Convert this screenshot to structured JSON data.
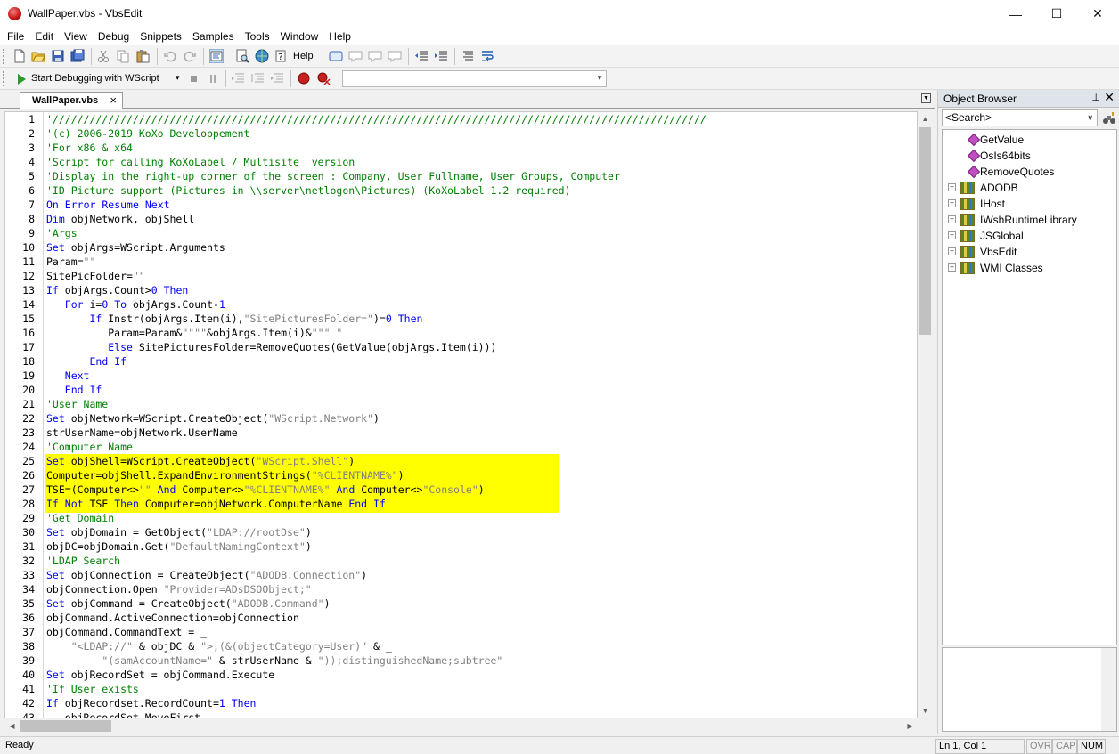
{
  "window": {
    "title": "WallPaper.vbs - VbsEdit",
    "minimize": "—",
    "maximize": "☐",
    "close": "✕"
  },
  "menu": [
    "File",
    "Edit",
    "View",
    "Debug",
    "Snippets",
    "Samples",
    "Tools",
    "Window",
    "Help"
  ],
  "toolbar": {
    "help_label": "Help",
    "debug_label": "Start Debugging with WScript",
    "debug_dropdown": "▾",
    "combo_value": ""
  },
  "editor": {
    "tab_label": "WallPaper.vbs",
    "tab_close": "×",
    "highlight_color": "#ffff00",
    "colors": {
      "comment": "#008000",
      "keyword": "#0000ff",
      "string": "#808080",
      "number": "#0000ff"
    },
    "lines": [
      {
        "n": "1",
        "t": "'//////////////////////////////////////////////////////////////////////////////////////////////////////////"
      },
      {
        "n": "2",
        "t": "'(c) 2006-2019 KoXo Developpement"
      },
      {
        "n": "3",
        "t": "'For x86 & x64"
      },
      {
        "n": "4",
        "t": "'Script for calling KoXoLabel / Multisite  version"
      },
      {
        "n": "5",
        "t": "'Display in the right-up corner of the screen : Company, User Fullname, User Groups, Computer"
      },
      {
        "n": "6",
        "t": "'ID Picture support (Pictures in \\\\server\\netlogon\\Pictures) (KoXoLabel 1.2 required)"
      },
      {
        "n": "7",
        "t": "On Error Resume Next"
      },
      {
        "n": "8",
        "t": "Dim objNetwork, objShell"
      },
      {
        "n": "9",
        "t": "'Args"
      },
      {
        "n": "10",
        "t": "Set objArgs=WScript.Arguments"
      },
      {
        "n": "11",
        "t": "Param=\"\""
      },
      {
        "n": "12",
        "t": "SitePicFolder=\"\""
      },
      {
        "n": "13",
        "t": "If objArgs.Count>0 Then"
      },
      {
        "n": "14",
        "t": "   For i=0 To objArgs.Count-1"
      },
      {
        "n": "15",
        "t": "       If Instr(objArgs.Item(i),\"SitePicturesFolder=\")=0 Then"
      },
      {
        "n": "16",
        "t": "          Param=Param&\"\"\"\"&objArgs.Item(i)&\"\"\" \""
      },
      {
        "n": "17",
        "t": "          Else SitePicturesFolder=RemoveQuotes(GetValue(objArgs.Item(i)))"
      },
      {
        "n": "18",
        "t": "       End If"
      },
      {
        "n": "19",
        "t": "   Next"
      },
      {
        "n": "20",
        "t": "   End If"
      },
      {
        "n": "21",
        "t": "'User Name"
      },
      {
        "n": "22",
        "t": "Set objNetwork=WScript.CreateObject(\"WScript.Network\")"
      },
      {
        "n": "23",
        "t": "strUserName=objNetwork.UserName"
      },
      {
        "n": "24",
        "t": "'Computer Name"
      },
      {
        "n": "25",
        "t": "Set objShell=WScript.CreateObject(\"WScript.Shell\")",
        "hl": true
      },
      {
        "n": "26",
        "t": "Computer=objShell.ExpandEnvironmentStrings(\"%CLIENTNAME%\")",
        "hl": true
      },
      {
        "n": "27",
        "t": "TSE=(Computer<>\"\" And Computer<>\"%CLIENTNAME%\" And Computer<>\"Console\")",
        "hl": true
      },
      {
        "n": "28",
        "t": "If Not TSE Then Computer=objNetwork.ComputerName End If",
        "hl": true
      },
      {
        "n": "29",
        "t": "'Get Domain"
      },
      {
        "n": "30",
        "t": "Set objDomain = GetObject(\"LDAP://rootDse\")"
      },
      {
        "n": "31",
        "t": "objDC=objDomain.Get(\"DefaultNamingContext\")"
      },
      {
        "n": "32",
        "t": "'LDAP Search"
      },
      {
        "n": "33",
        "t": "Set objConnection = CreateObject(\"ADODB.Connection\")"
      },
      {
        "n": "34",
        "t": "objConnection.Open \"Provider=ADsDSOObject;\""
      },
      {
        "n": "35",
        "t": "Set objCommand = CreateObject(\"ADODB.Command\")"
      },
      {
        "n": "36",
        "t": "objCommand.ActiveConnection=objConnection"
      },
      {
        "n": "37",
        "t": "objCommand.CommandText = _"
      },
      {
        "n": "38",
        "t": "    \"<LDAP://\" & objDC & \">;(&(objectCategory=User)\" & _"
      },
      {
        "n": "39",
        "t": "         \"(samAccountName=\" & strUserName & \"));distinguishedName;subtree\""
      },
      {
        "n": "40",
        "t": "Set objRecordSet = objCommand.Execute"
      },
      {
        "n": "41",
        "t": "'If User exists"
      },
      {
        "n": "42",
        "t": "If objRecordset.RecordCount=1 Then"
      },
      {
        "n": "43",
        "t": "   objRecordSet.MoveFirst"
      }
    ]
  },
  "object_browser": {
    "title": "Object Browser",
    "pin": "📌",
    "close": "✕",
    "search_placeholder": "<Search>",
    "items": [
      {
        "label": "GetValue",
        "kind": "method"
      },
      {
        "label": "OsIs64bits",
        "kind": "method"
      },
      {
        "label": "RemoveQuotes",
        "kind": "method"
      },
      {
        "label": "ADODB",
        "kind": "library"
      },
      {
        "label": "IHost",
        "kind": "library"
      },
      {
        "label": "IWshRuntimeLibrary",
        "kind": "library"
      },
      {
        "label": "JSGlobal",
        "kind": "library"
      },
      {
        "label": "VbsEdit",
        "kind": "library"
      },
      {
        "label": "WMI Classes",
        "kind": "library"
      }
    ]
  },
  "status": {
    "text": "Ready",
    "position": "Ln 1, Col 1",
    "ovr": "OVR",
    "cap": "CAP",
    "num": "NUM"
  }
}
